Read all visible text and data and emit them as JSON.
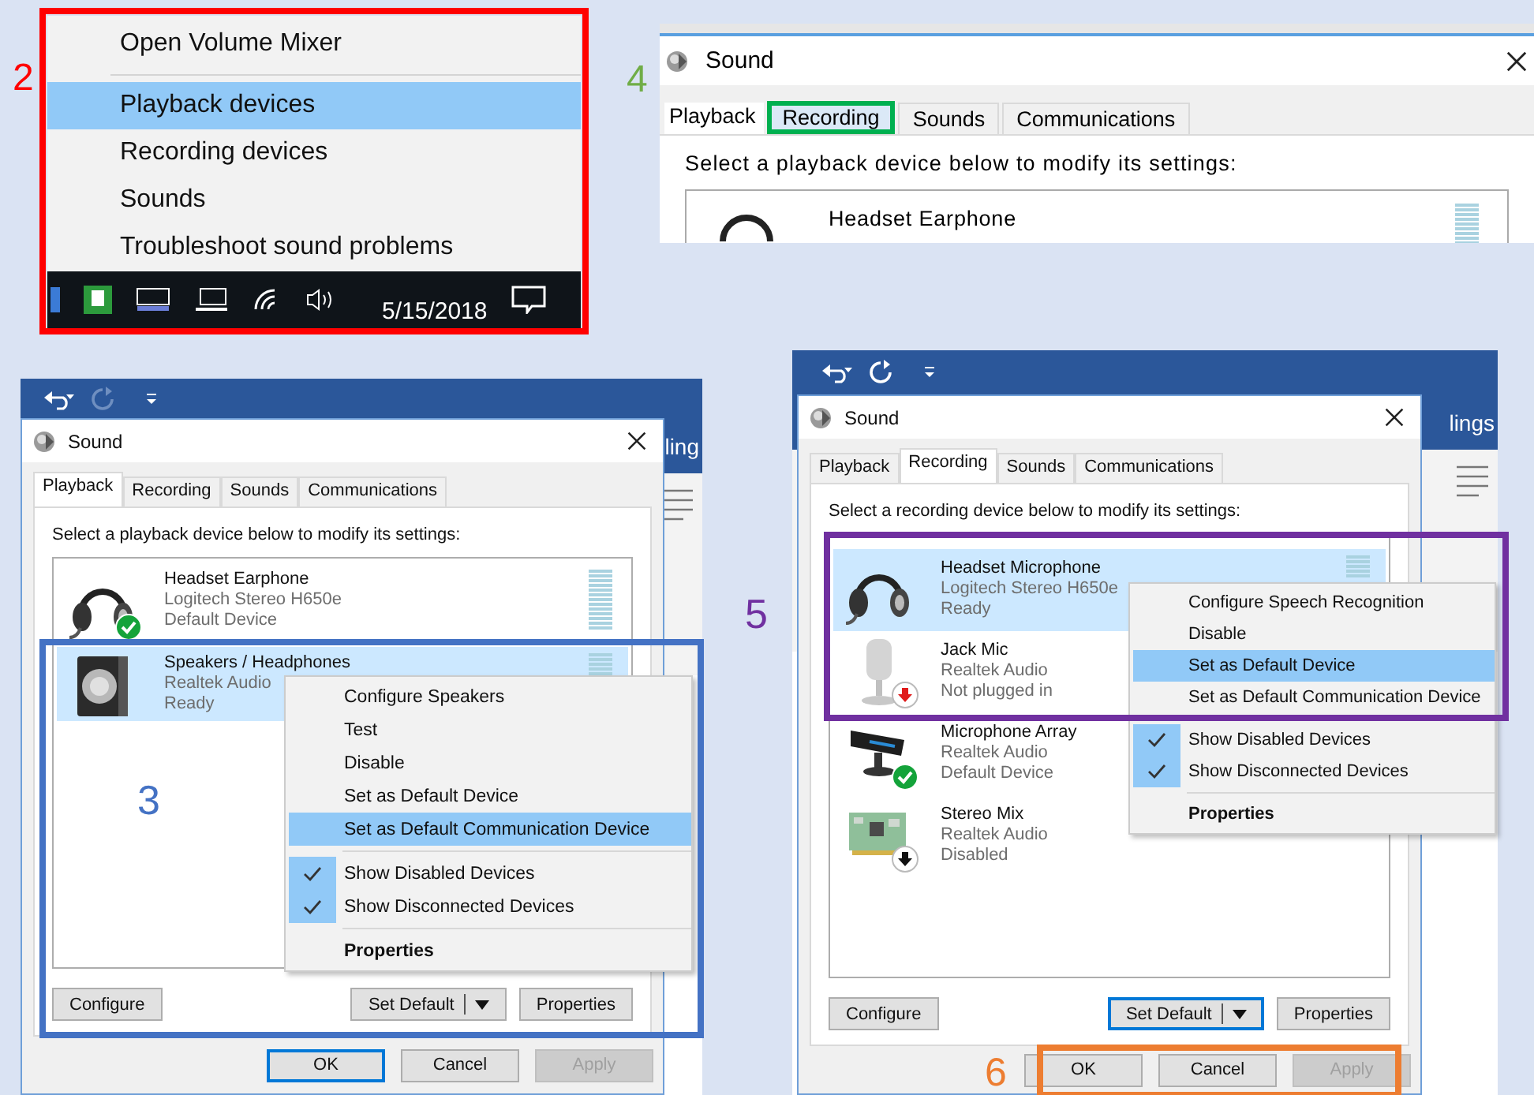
{
  "tray_panel": {
    "step": "2",
    "menu": [
      {
        "kind": "command",
        "label": "Open Volume Mixer",
        "selected": false
      },
      {
        "kind": "separator"
      },
      {
        "kind": "command",
        "label": "Playback devices",
        "selected": true
      },
      {
        "kind": "command",
        "label": "Recording devices",
        "selected": false
      },
      {
        "kind": "command",
        "label": "Sounds",
        "selected": false
      },
      {
        "kind": "command",
        "label": "Troubleshoot sound problems",
        "selected": false
      }
    ],
    "taskbar": {
      "date": "5/15/2018"
    }
  },
  "tab_panel": {
    "step": "4",
    "title": "Sound",
    "tabs": [
      {
        "label": "Playback",
        "selected": true,
        "highlighted": false
      },
      {
        "label": "Recording",
        "selected": false,
        "highlighted": true
      },
      {
        "label": "Sounds",
        "selected": false,
        "highlighted": false
      },
      {
        "label": "Communications",
        "selected": false,
        "highlighted": false
      }
    ],
    "instruction": "Select a playback device below to modify its settings:",
    "device": {
      "name": "Headset Earphone"
    }
  },
  "playback_panel": {
    "step": "3",
    "app_title_fragment": "ling",
    "title": "Sound",
    "tabs": [
      {
        "label": "Playback",
        "selected": true
      },
      {
        "label": "Recording",
        "selected": false
      },
      {
        "label": "Sounds",
        "selected": false
      },
      {
        "label": "Communications",
        "selected": false
      }
    ],
    "instruction": "Select a playback device below to modify its settings:",
    "devices": [
      {
        "kind": "headset",
        "default_device": true,
        "unplugged": false,
        "disabled": false,
        "name": "Headset Earphone",
        "driver": "Logitech Stereo H650e",
        "status": "Default Device",
        "selected": false,
        "meter": true
      },
      {
        "kind": "speaker",
        "default_device": false,
        "unplugged": false,
        "disabled": false,
        "name": "Speakers / Headphones",
        "driver": "Realtek Audio",
        "status": "Ready",
        "selected": true,
        "meter": true
      }
    ],
    "context_menu": [
      {
        "kind": "command",
        "label": "Configure Speakers",
        "selected": false
      },
      {
        "kind": "command",
        "label": "Test",
        "selected": false
      },
      {
        "kind": "command",
        "label": "Disable",
        "selected": false
      },
      {
        "kind": "command",
        "label": "Set as Default Device",
        "selected": false
      },
      {
        "kind": "command",
        "label": "Set as Default Communication Device",
        "selected": true
      },
      {
        "kind": "separator"
      },
      {
        "kind": "toggle",
        "label": "Show Disabled Devices",
        "selected": false,
        "checked": true
      },
      {
        "kind": "toggle",
        "label": "Show Disconnected Devices",
        "selected": false,
        "checked": true
      },
      {
        "kind": "separator"
      },
      {
        "kind": "default",
        "label": "Properties",
        "selected": false
      }
    ],
    "buttons": [
      {
        "kind": "plain",
        "label": "Configure",
        "focused": false
      },
      {
        "kind": "split",
        "label": "Set Default",
        "focused": false
      },
      {
        "kind": "plain",
        "label": "Properties",
        "focused": false
      }
    ],
    "dialog_buttons": [
      {
        "label": "OK",
        "focused": true,
        "disabled": false
      },
      {
        "label": "Cancel",
        "focused": false,
        "disabled": false
      },
      {
        "label": "Apply",
        "focused": false,
        "disabled": true
      }
    ]
  },
  "recording_panel": {
    "step": "5",
    "footer_step": "6",
    "app_title_fragment": "lings",
    "title": "Sound",
    "tabs": [
      {
        "label": "Playback",
        "selected": false
      },
      {
        "label": "Recording",
        "selected": true
      },
      {
        "label": "Sounds",
        "selected": false
      },
      {
        "label": "Communications",
        "selected": false
      }
    ],
    "instruction": "Select a recording device below to modify its settings:",
    "devices": [
      {
        "kind": "headset",
        "default_device": false,
        "unplugged": false,
        "disabled": false,
        "name": "Headset Microphone",
        "driver": "Logitech Stereo H650e",
        "status": "Ready",
        "selected": true,
        "meter": true
      },
      {
        "kind": "microphone",
        "default_device": false,
        "unplugged": true,
        "disabled": false,
        "name": "Jack Mic",
        "driver": "Realtek Audio",
        "status": "Not plugged in",
        "selected": false,
        "meter": false
      },
      {
        "kind": "mic-array",
        "default_device": true,
        "unplugged": false,
        "disabled": false,
        "name": "Microphone Array",
        "driver": "Realtek Audio",
        "status": "Default Device",
        "selected": false,
        "meter": false
      },
      {
        "kind": "sound-card",
        "default_device": false,
        "unplugged": false,
        "disabled": true,
        "name": "Stereo Mix",
        "driver": "Realtek Audio",
        "status": "Disabled",
        "selected": false,
        "meter": false
      }
    ],
    "context_menu": [
      {
        "kind": "command",
        "label": "Configure Speech Recognition",
        "selected": false
      },
      {
        "kind": "command",
        "label": "Disable",
        "selected": false
      },
      {
        "kind": "command",
        "label": "Set as Default Device",
        "selected": true
      },
      {
        "kind": "command",
        "label": "Set as Default Communication Device",
        "selected": false
      },
      {
        "kind": "separator"
      },
      {
        "kind": "toggle",
        "label": "Show Disabled Devices",
        "selected": false,
        "checked": true
      },
      {
        "kind": "toggle",
        "label": "Show Disconnected Devices",
        "selected": false,
        "checked": true
      },
      {
        "kind": "separator"
      },
      {
        "kind": "default",
        "label": "Properties",
        "selected": false
      }
    ],
    "buttons": [
      {
        "kind": "plain",
        "label": "Configure",
        "focused": false
      },
      {
        "kind": "split",
        "label": "Set Default",
        "focused": true
      },
      {
        "kind": "plain",
        "label": "Properties",
        "focused": false
      }
    ],
    "dialog_buttons": [
      {
        "label": "OK",
        "focused": false,
        "disabled": false
      },
      {
        "label": "Cancel",
        "focused": false,
        "disabled": false
      },
      {
        "label": "Apply",
        "focused": false,
        "disabled": true
      }
    ]
  }
}
